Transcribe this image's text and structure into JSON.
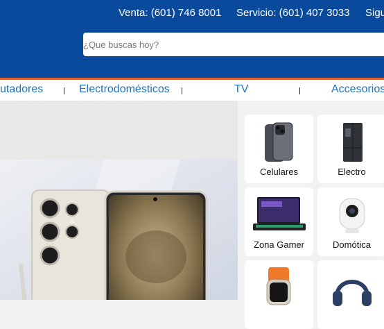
{
  "header": {
    "sales": "Venta: (601) 746 8001",
    "service": "Servicio: (601) 407 3033",
    "follow": "Sigu",
    "search_placeholder": "¿Que buscas hoy?"
  },
  "nav": {
    "items": [
      "utadores",
      "Electrodomésticos",
      "TV",
      "Accesorios"
    ]
  },
  "categories": [
    {
      "label": "Celulares",
      "icon": "smartphone-icon"
    },
    {
      "label": "Electro",
      "icon": "refrigerator-icon"
    },
    {
      "label": "Zona Gamer",
      "icon": "gaming-laptop-icon"
    },
    {
      "label": "Domótica",
      "icon": "security-camera-icon"
    },
    {
      "label": "",
      "icon": "smartwatch-icon"
    },
    {
      "label": "",
      "icon": "headphones-icon"
    }
  ],
  "colors": {
    "header_bg": "#0a4a9c",
    "accent": "#e0622b",
    "nav_text": "#1e73be"
  }
}
